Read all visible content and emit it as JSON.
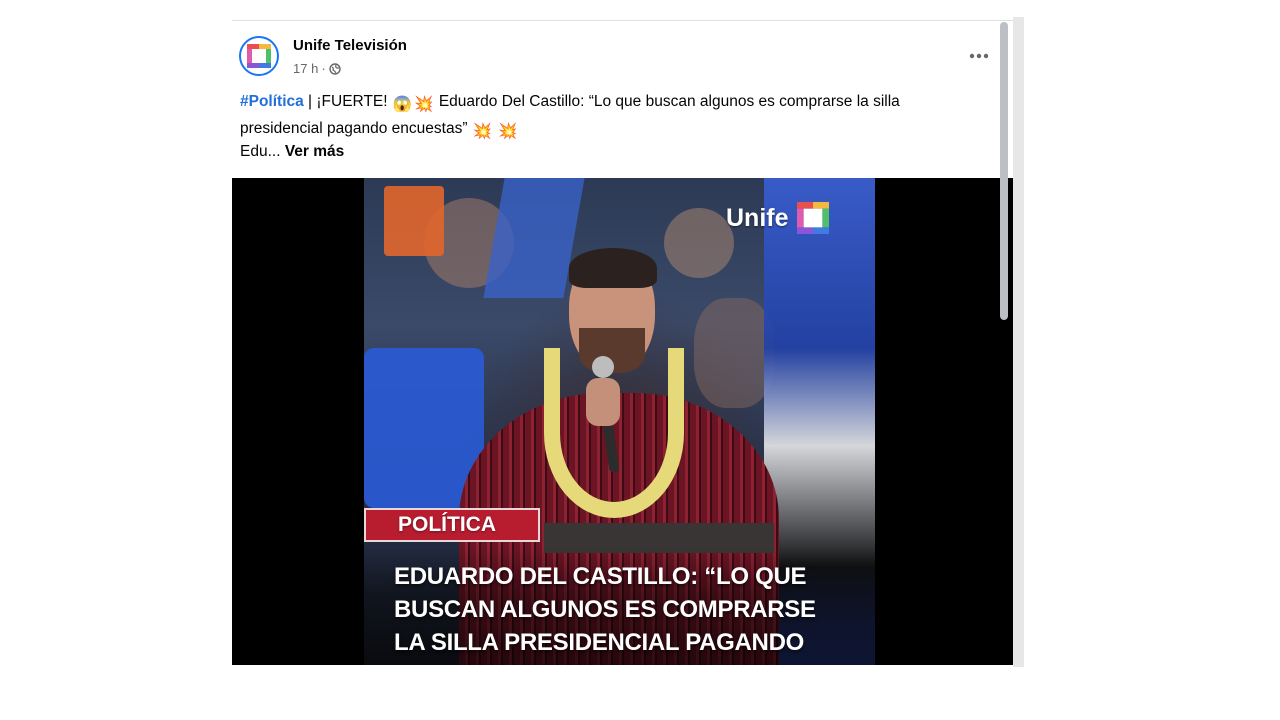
{
  "post": {
    "page_name": "Unife Televisión",
    "time": "17 h",
    "separator": "·",
    "audience_icon": "globe-icon",
    "more_icon": "more-options-icon",
    "caption": {
      "hashtag": "#Política",
      "text_before_emoji": " | ¡FUERTE! ",
      "emoji_1": "😱",
      "emoji_2": "💥",
      "text_main": " Eduardo Del Castillo: “Lo que buscan algunos es comprarse la silla presidencial pagando encuestas” ",
      "emoji_3": "💥",
      "emoji_4": "💥",
      "truncated_text": "Edu... ",
      "see_more": "Ver más"
    }
  },
  "video": {
    "watermark": "Unife",
    "tag": "POLÍTICA",
    "headline": "EDUARDO DEL CASTILLO: “LO QUE\nBUSCAN ALGUNOS ES COMPRARSE\nLA SILLA PRESIDENCIAL PAGANDO"
  },
  "colors": {
    "hashtag": "#216fdb",
    "tag_bg": "#b71c2f",
    "avatar_ring": "#1877f2"
  }
}
